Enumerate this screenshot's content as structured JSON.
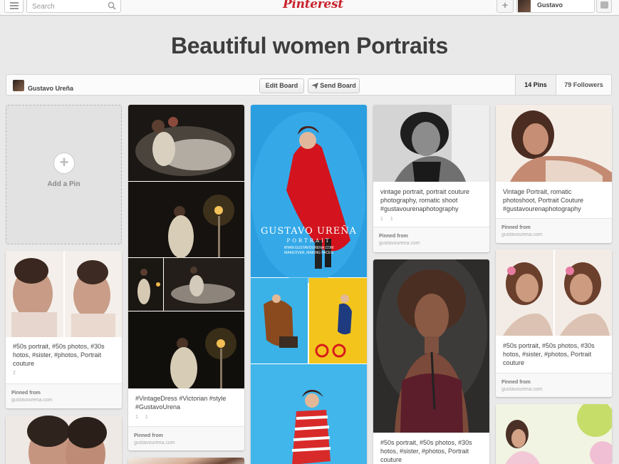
{
  "topbar": {
    "search_placeholder": "Search",
    "logo": "Pinterest",
    "user_name": "Gustavo"
  },
  "board": {
    "title": "Beautiful women Portraits",
    "owner": "Gustavo Ureña",
    "edit_label": "Edit Board",
    "send_label": "Send Board",
    "pins_count": "14 Pins",
    "followers_count": "79 Followers"
  },
  "add_pin": {
    "label": "Add a Pin"
  },
  "pins": [
    {
      "description": "#50s portrait, #50s photos, #30s hotos, #sister, #photos, Portrait couture",
      "repins": "2",
      "pinned_from_label": "Pinned from",
      "source": "gustavourena.com"
    },
    {
      "description": "#VintageDress #Victorian #style #GustavoUrena",
      "repins": "1",
      "likes": "1",
      "pinned_from_label": "Pinned from",
      "source": "gustavourena.com"
    },
    {
      "watermark_name": "GUSTAVO UREÑA",
      "watermark_sub": "PORTRAIT",
      "watermark_url": "WWW.GUSTAVOURENA.COM",
      "watermark_tagline": "MAKEOVER, MAKING FACES"
    },
    {
      "description": "vintage portrait, portrait couture photography, romatic shoot #gustavourenaphotography",
      "repins": "1",
      "likes": "1",
      "pinned_from_label": "Pinned from",
      "source": "gustavourena.com"
    },
    {
      "description": "#50s portrait, #50s photos, #30s hotos, #sister, #photos, Portrait couture"
    },
    {
      "description": "Vintage Portrait, romatic photoshoot, Portrait Couture #gustavourenaphotography",
      "pinned_from_label": "Pinned from",
      "source": "gustavourena.com"
    },
    {
      "description": "#50s portrait, #50s photos, #30s hotos, #sister, #photos, Portrait couture",
      "pinned_from_label": "Pinned from",
      "source": "gustavourena.com"
    }
  ]
}
